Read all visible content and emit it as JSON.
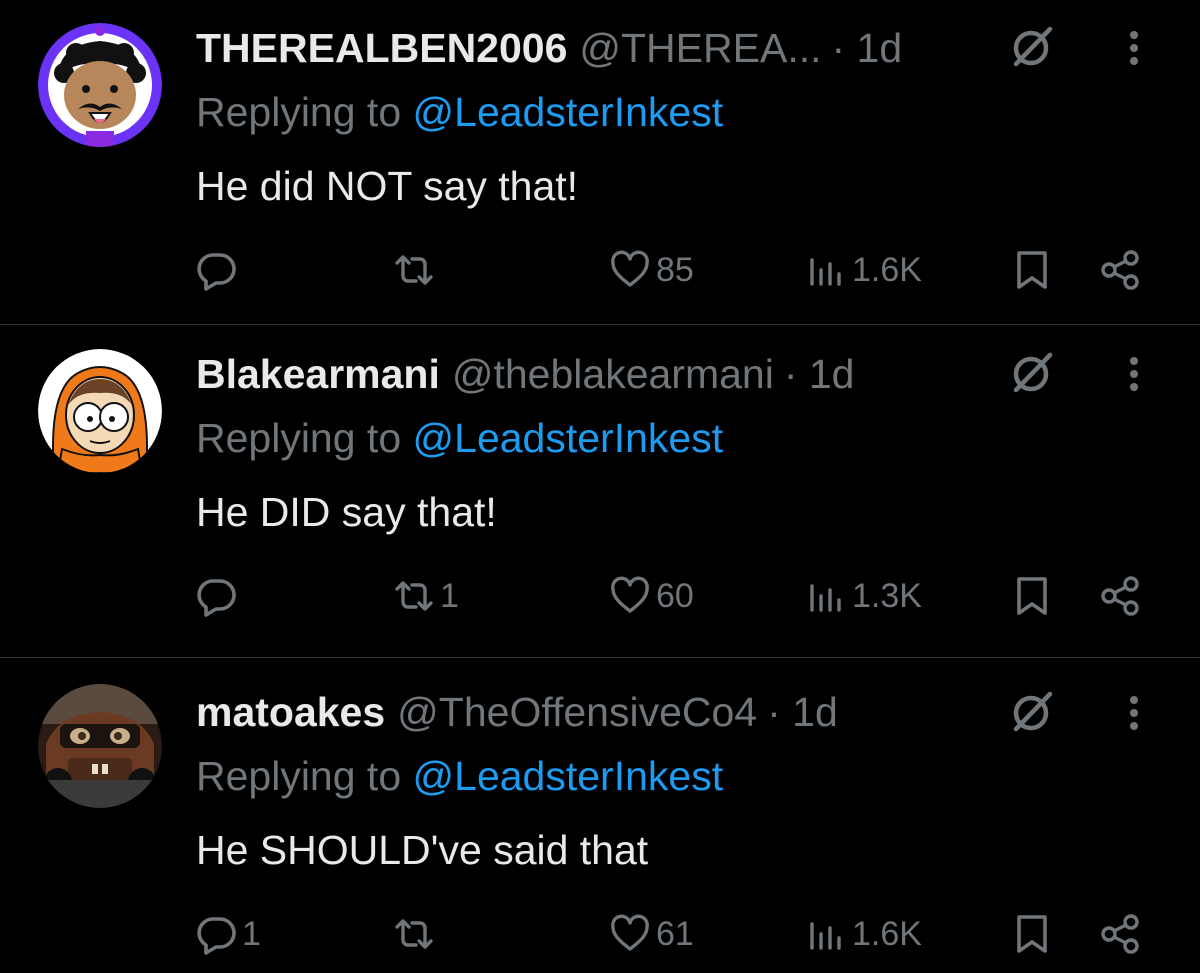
{
  "colors": {
    "background": "#000000",
    "primary_text": "#e7e9ea",
    "secondary_text": "#71767b",
    "link": "#1d9bf0",
    "divider": "#2f3336"
  },
  "replies": [
    {
      "display_name": "THEREALBEN2006",
      "handle": "@THEREA...",
      "time": "· 1d",
      "replying_prefix": "Replying to",
      "replying_to": "@LeadsterInkest",
      "text": "He did NOT say that!",
      "comments": "",
      "retweets": "",
      "likes": "85",
      "views": "1.6K",
      "avatar_icon": "cartoon-mustache-avatar",
      "avatar_ring_color": "#6a33f5"
    },
    {
      "display_name": "Blakearmani",
      "handle": "@theblakearmani",
      "time": "· 1d",
      "replying_prefix": "Replying to",
      "replying_to": "@LeadsterInkest",
      "text": "He DID say that!",
      "comments": "",
      "retweets": "1",
      "likes": "60",
      "views": "1.3K",
      "avatar_icon": "orange-hood-cartoon-avatar",
      "avatar_ring_color": "#ffffff"
    },
    {
      "display_name": "matoakes",
      "handle": "@TheOffensiveCo4",
      "time": "· 1d",
      "replying_prefix": "Replying to",
      "replying_to": "@LeadsterInkest",
      "text": "He SHOULD've said that",
      "comments": "1",
      "retweets": "",
      "likes": "61",
      "views": "1.6K",
      "avatar_icon": "rusty-tow-truck-avatar",
      "avatar_ring_color": "#2a1c14"
    }
  ],
  "icons": {
    "grok": "grok-icon",
    "more": "more-vertical-icon",
    "comment": "comment-icon",
    "retweet": "retweet-icon",
    "like": "heart-icon",
    "views": "views-icon",
    "bookmark": "bookmark-icon",
    "share": "share-icon"
  }
}
